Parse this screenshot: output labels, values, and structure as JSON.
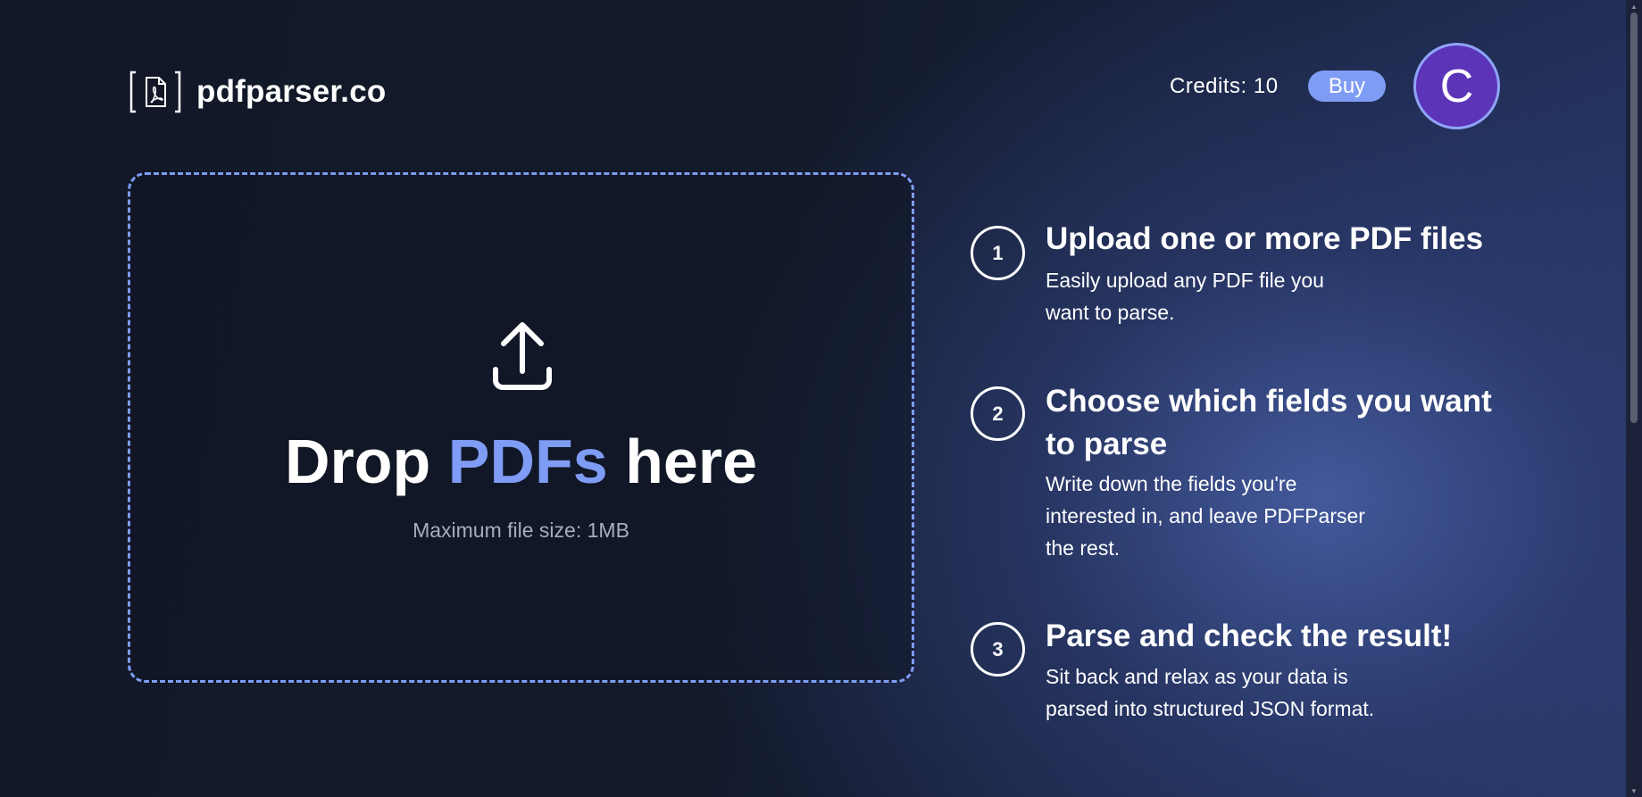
{
  "header": {
    "brand": "pdfparser.co",
    "logo_icon": "pdf-file-icon",
    "credits_label": "Credits: 10",
    "buy_label": "Buy",
    "avatar_initial": "C"
  },
  "dropzone": {
    "icon": "upload-icon",
    "title_prefix": "Drop",
    "title_accent": "PDFs",
    "title_suffix": "here",
    "max_size": "Maximum file size: 1MB"
  },
  "steps": [
    {
      "number": "1",
      "title": "Upload one or more PDF files",
      "description": "Easily upload any PDF file you want to parse."
    },
    {
      "number": "2",
      "title": "Choose which fields you want to parse",
      "description": "Write down the fields you're interested in, and leave PDFParser the rest."
    },
    {
      "number": "3",
      "title": "Parse and check the result!",
      "description": "Sit back and relax as your data is parsed into structured JSON format."
    }
  ],
  "colors": {
    "accent": "#7f9cf5",
    "avatar_bg": "#5b34b8",
    "background_dark": "#121827",
    "background_light": "#263463"
  }
}
